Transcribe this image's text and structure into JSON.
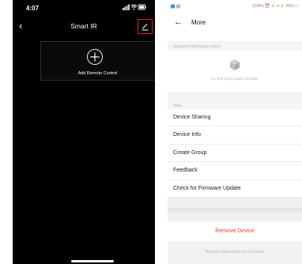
{
  "left_screen": {
    "status_time": "4:07",
    "title": "Smart IR",
    "add_remote_label": "Add Remote Control"
  },
  "right_screen": {
    "status_text": "119B/s ⏰ ᯤ .ıl ⚡ 85% ▭",
    "title": "More",
    "supported_header": "Supported Third-party Control",
    "empty_text": "No third party support available",
    "other_header": "Other",
    "menu_items": [
      {
        "label": "Device Sharing"
      },
      {
        "label": "Device Info"
      },
      {
        "label": "Create Group"
      },
      {
        "label": "Feedback"
      },
      {
        "label": "Check for Firmware Update"
      }
    ],
    "remove_label": "Remove Device",
    "restore_label": "Restore Manufacturer Defaults"
  },
  "colors": {
    "left_background": "#000000",
    "highlight_red": "#e0202a",
    "remove_red": "#e8413a",
    "right_background": "#ffffff",
    "section_gray": "#f4f4f4"
  }
}
